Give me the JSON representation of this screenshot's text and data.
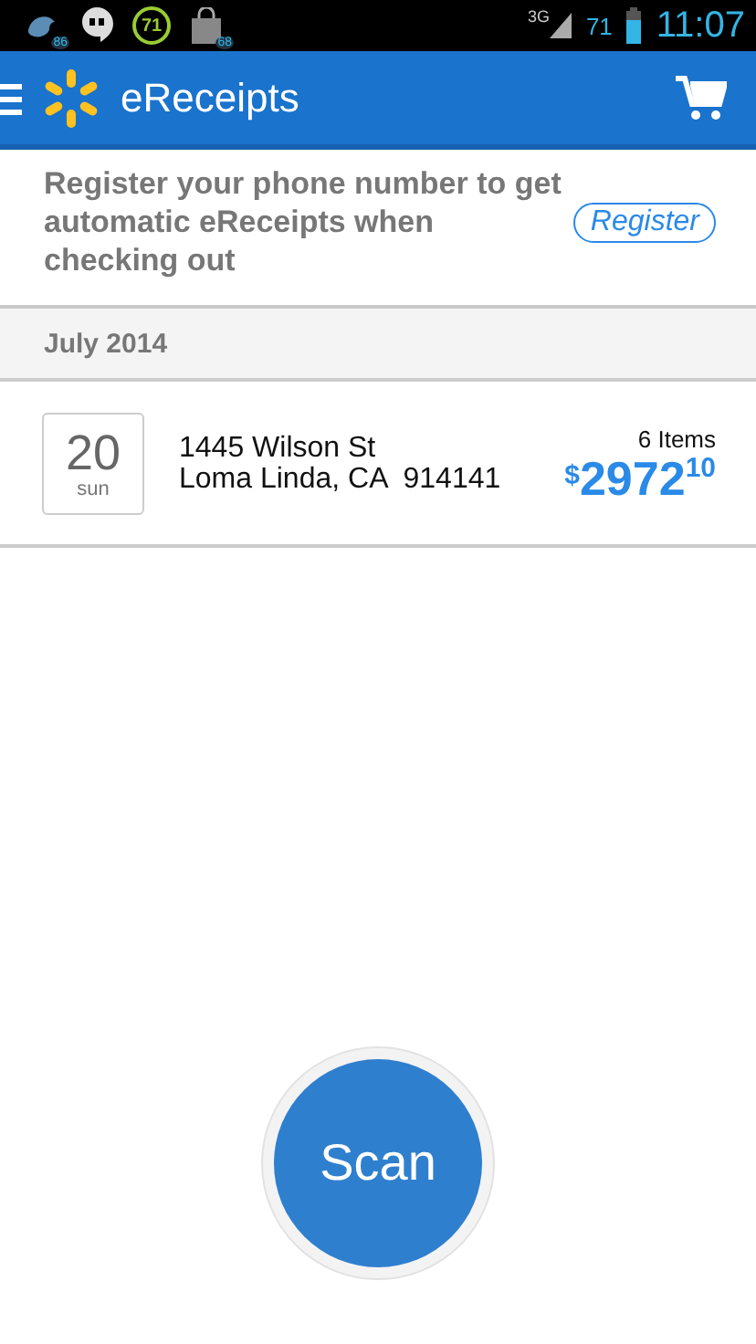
{
  "status_bar": {
    "notifications": [
      {
        "kind": "bird",
        "badge": "86"
      },
      {
        "kind": "chat"
      },
      {
        "kind": "ring",
        "badge": "71"
      },
      {
        "kind": "store",
        "badge": "68"
      }
    ],
    "network": "3G",
    "battery": "71",
    "time": "11:07"
  },
  "app_bar": {
    "title": "eReceipts"
  },
  "banner": {
    "text": "Register your phone number to get automatic eReceipts when checking out",
    "button": "Register"
  },
  "sections": [
    {
      "title": "July 2014",
      "receipts": [
        {
          "day": "20",
          "weekday": "sun",
          "address_line_1": "1445 Wilson St",
          "address_line_2": "Loma Linda, CA  914141",
          "items": "6 Items",
          "currency": "$",
          "amount": "2972",
          "cents": "10"
        }
      ]
    }
  ],
  "scan_button": "Scan"
}
